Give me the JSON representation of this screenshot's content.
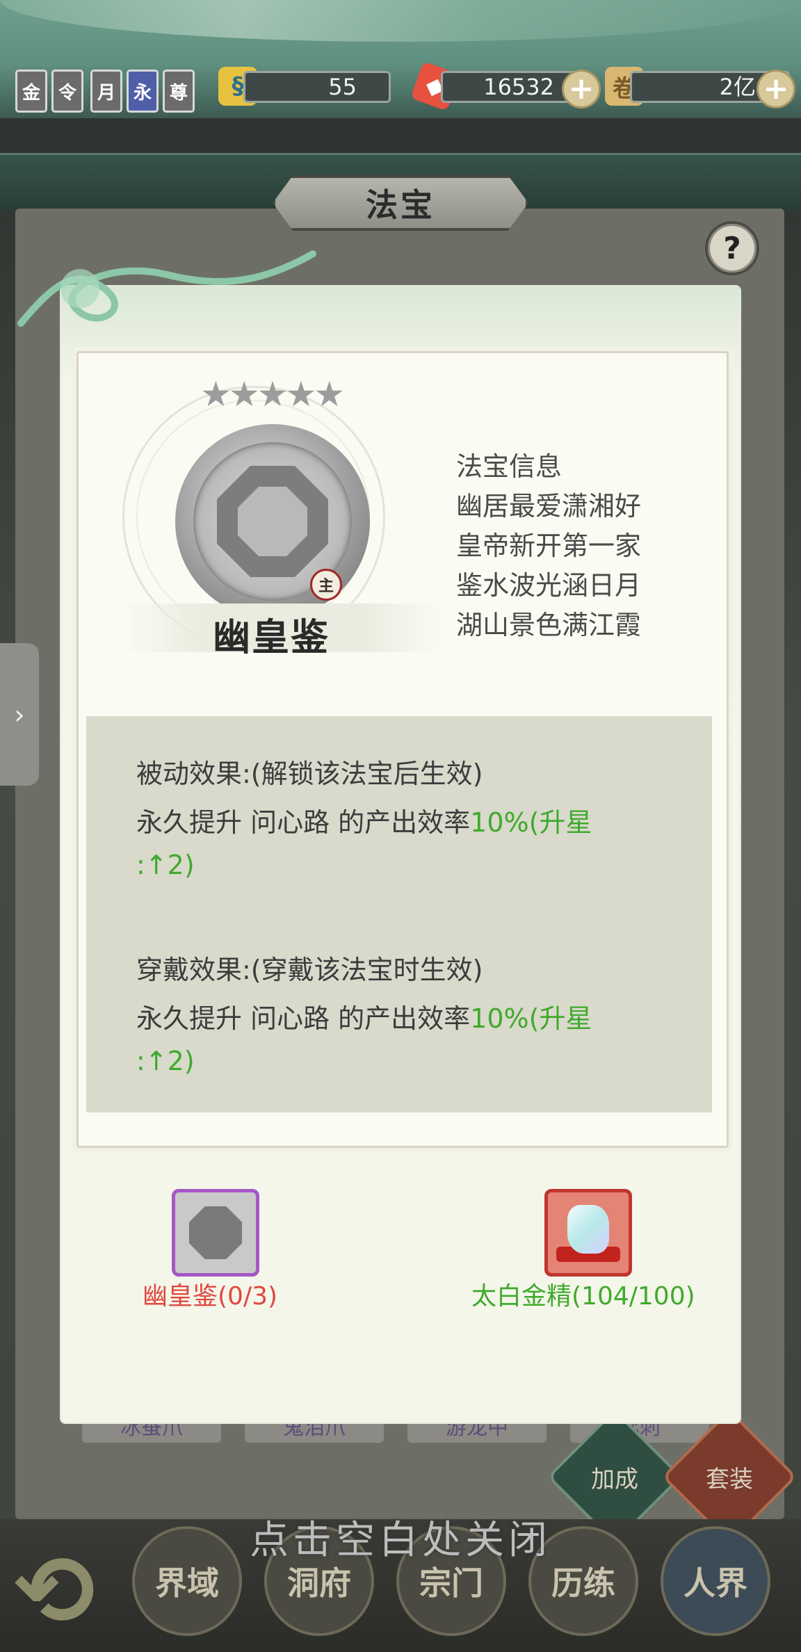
{
  "top_bar": {
    "badges": [
      "金",
      "令",
      "月",
      "永",
      "尊"
    ],
    "resources": [
      {
        "name": "jade-token",
        "value": "55",
        "icon": "swirl-icon"
      },
      {
        "name": "crystal",
        "value": "16532",
        "icon": "red-crystal-icon"
      },
      {
        "name": "scroll",
        "value": "2亿",
        "icon": "scroll-icon"
      }
    ]
  },
  "background": {
    "title": "法宝",
    "help": "?",
    "tab_labels": [
      "冰蚕爪",
      "鬼泪爪",
      "游龙中",
      "蕊刺"
    ],
    "actions": [
      "加成",
      "套装"
    ],
    "nav": [
      "界域",
      "洞府",
      "宗门",
      "历练",
      "人界"
    ],
    "close_hint": "点击空白处关闭"
  },
  "modal": {
    "stars": "★★★★★",
    "main_seal": "主",
    "item_name": "幽皇鉴",
    "info_title": "法宝信息",
    "poem": [
      "幽居最爱潇湘好",
      "皇帝新开第一家",
      "鉴水波光涵日月",
      "湖山景色满江霞"
    ],
    "passive": {
      "title": "被动效果:(解锁该法宝后生效)",
      "line_prefix": "永久提升  问心路  的产出效率",
      "value": "10%",
      "upgrade": "(升星",
      "upgrade_tail": ":↑2)"
    },
    "wear": {
      "title": "穿戴效果:(穿戴该法宝时生效)",
      "line_prefix": "永久提升  问心路  的产出效率",
      "value": "10%",
      "upgrade": "(升星",
      "upgrade_tail": ":↑2)"
    },
    "costs": [
      {
        "label": "幽皇鉴(0/3)",
        "color": "#e0473e",
        "icon": "mirror-icon"
      },
      {
        "label": "太白金精(104/100)",
        "color": "#3faa2c",
        "icon": "crystal-ore-icon"
      }
    ]
  },
  "colors": {
    "green_accent": "#3faa2c",
    "red_accent": "#e0473e"
  }
}
